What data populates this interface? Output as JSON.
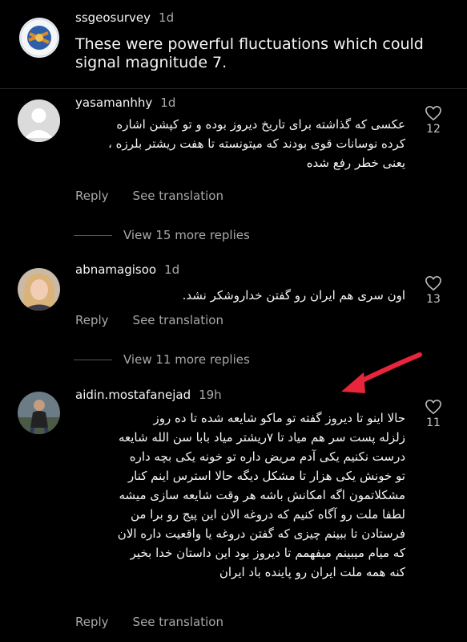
{
  "comments": [
    {
      "username": "ssgeosurvey",
      "time": "1d",
      "text_lines": [
        "These were powerful fluctuations which could",
        "signal magnitude 7."
      ],
      "avatar": "ssgeosurvey-logo-icon"
    },
    {
      "username": "yasamanhhy",
      "time": "1d",
      "text_lines": [
        "عکسی که گذاشته برای تاریخ دیروز بوده و تو کپشن اشاره",
        "کرده نوسانات قوی بودند که میتونسته تا هفت ریشتر بلرزه ،",
        "یعنی خطر رفع شده"
      ],
      "reply": "Reply",
      "see_translation": "See translation",
      "likes": "12",
      "view_replies": "View 15 more replies"
    },
    {
      "username": "abnamagisoo",
      "time": "1d",
      "text_lines": [
        "اون سری هم ایران رو گفتن خداروشکر نشد."
      ],
      "reply": "Reply",
      "see_translation": "See translation",
      "likes": "13",
      "view_replies": "View 11 more replies"
    },
    {
      "username": "aidin.mostafanejad",
      "time": "19h",
      "text_lines": [
        "حالا اینو تا دیروز گفته تو ماکو شایعه شده تا ده روز",
        "زلزله پست سر هم میاد تا ۷ریشتر میاد بابا سن الله شایعه",
        "درست نکنیم یکی آدم مریض داره تو خونه یکی بچه داره",
        "تو خونش یکی هزار تا مشکل دیگه حالا استرس اینم کنار",
        "مشکلاتمون اگه امکانش باشه هر وقت شایعه سازی میشه",
        "لطفا ملت رو آگاه کنیم که دروغه الان این پیج رو برا من",
        "فرستادن تا ببینم چیزی که گفتن دروغه یا واقعیت داره الان",
        "که میام میبینم میفهمم تا دیروز بود این داستان خدا بخیر",
        "کنه همه ملت ایران رو پاینده باد ایران"
      ],
      "reply": "Reply",
      "see_translation": "See translation",
      "likes": "11"
    }
  ],
  "colors": {
    "background": "#000000",
    "muted": "#a8a8a8",
    "arrow": "#e8253a"
  }
}
